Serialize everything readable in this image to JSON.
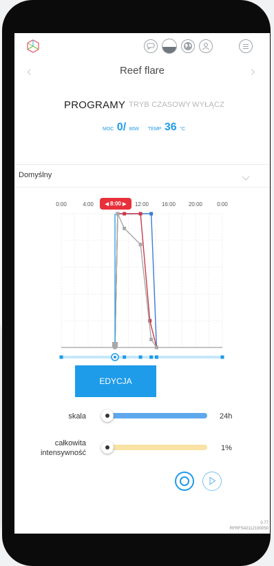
{
  "header": {
    "title": "Reef flare",
    "logo_icon": "cube-logo-icon",
    "icons": [
      "chat-icon",
      "moon-icon",
      "globe-icon",
      "user-icon",
      "menu-icon"
    ]
  },
  "tabs": [
    {
      "label": "PROGRAMY",
      "active": true
    },
    {
      "label": "TRYB CZASOWY",
      "active": false
    },
    {
      "label": "WYŁĄCZ",
      "active": false
    }
  ],
  "status": {
    "power_label": "MOC",
    "power_value": "0/",
    "power_unit": "80W",
    "temp_label": "TEMP",
    "temp_value": "36",
    "temp_unit": "°C"
  },
  "program": {
    "selected": "Domyślny"
  },
  "chart": {
    "ticks": [
      "0:00",
      "4:00",
      "8:00",
      "12:00",
      "16:00",
      "20:00",
      "0:00"
    ],
    "current_time": "8:00"
  },
  "chart_data": {
    "type": "line",
    "x_unit": "hours",
    "xlim": [
      0,
      24
    ],
    "ylim": [
      0,
      100
    ],
    "series": [
      {
        "color": "#3a7bd5",
        "x": [
          8.0,
          8.4,
          13.4,
          14.2
        ],
        "y": [
          0,
          100,
          100,
          0
        ]
      },
      {
        "color": "#c93a4a",
        "x": [
          8.0,
          8.4,
          9.4,
          11.8,
          13.2,
          14.2
        ],
        "y": [
          0,
          100,
          100,
          100,
          20,
          0
        ]
      },
      {
        "color": "#a8a8a8",
        "x": [
          8.0,
          8.4,
          9.4,
          11.8,
          13.4,
          14.2
        ],
        "y": [
          0,
          100,
          89,
          77,
          6,
          0
        ]
      },
      {
        "color": "#29a8e0",
        "x": [
          8.0,
          8.0
        ],
        "y": [
          0,
          100
        ]
      }
    ],
    "handles_x": [
      0,
      8.0,
      9.4,
      11.8,
      13.4,
      14.2,
      24
    ]
  },
  "edit_button": {
    "label": "EDYCJA"
  },
  "sliders": [
    {
      "label": "skala",
      "value": "24h",
      "level": 1.0,
      "color": "#5fa8ee"
    },
    {
      "label": "całkowita\nintensywność",
      "value": "1%",
      "level": 1.0,
      "color": "#f8e3a5"
    }
  ],
  "footer": {
    "version": "0.77",
    "serial": "RFRFS42112190050"
  },
  "colors": {
    "accent": "#1e9be9",
    "badge": "#e8303b"
  }
}
